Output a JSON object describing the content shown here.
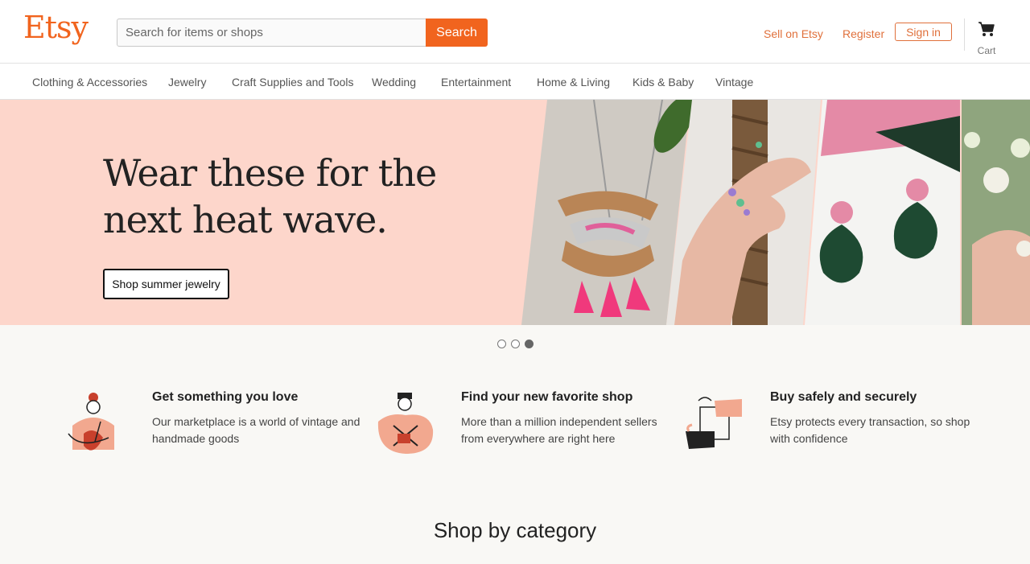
{
  "header": {
    "logo": "Etsy",
    "search_placeholder": "Search for items or shops",
    "search_button": "Search",
    "sell_link": "Sell on Etsy",
    "register_link": "Register",
    "signin_button": "Sign in",
    "cart_label": "Cart"
  },
  "categories": [
    "Clothing & Accessories",
    "Jewelry",
    "Craft Supplies and Tools",
    "Wedding",
    "Entertainment",
    "Home & Living",
    "Kids & Baby",
    "Vintage"
  ],
  "hero": {
    "title": "Wear these for the next heat wave.",
    "cta": "Shop summer jewelry",
    "slide_count": 3,
    "active_slide": 3
  },
  "value_props": [
    {
      "title": "Get something you love",
      "text": "Our marketplace is a world of vintage and handmade goods",
      "icon": "person-holding-heart-icon"
    },
    {
      "title": "Find your new favorite shop",
      "text": "More than a million independent sellers from everywhere are right here",
      "icon": "craftsperson-icon"
    },
    {
      "title": "Buy safely and securely",
      "text": "Etsy protects every transaction, so shop with confidence",
      "icon": "hands-exchange-icon"
    }
  ],
  "section_title": "Shop by category",
  "colors": {
    "brand": "#f1641e",
    "hero_bg": "#fdd6cb",
    "page_bg": "#f9f8f5"
  }
}
